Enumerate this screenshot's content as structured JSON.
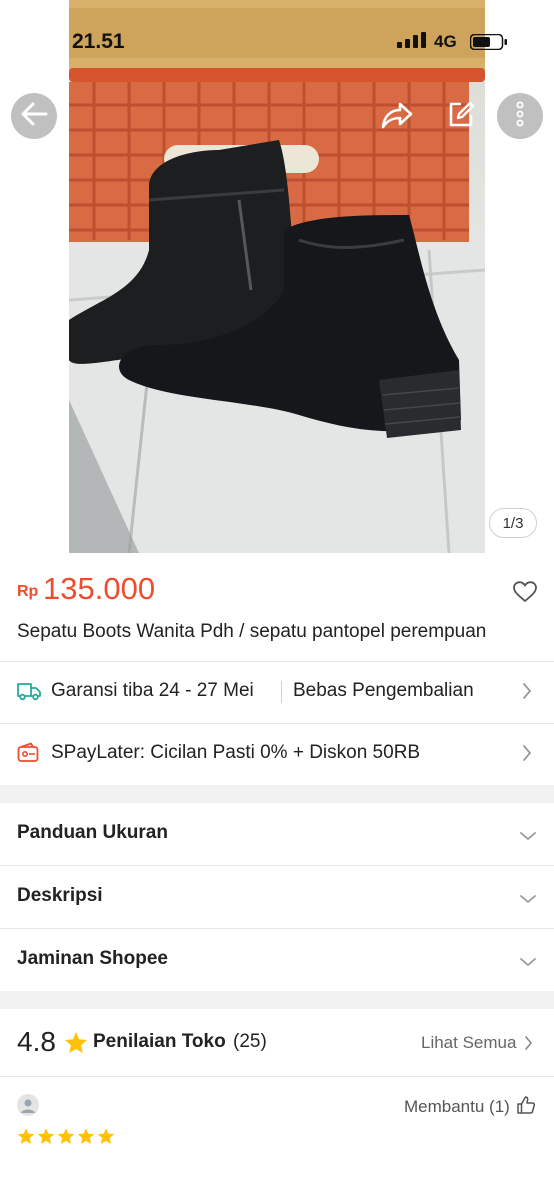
{
  "status_bar": {
    "time": "21.51",
    "network": "4G"
  },
  "gallery": {
    "counter": "1/3"
  },
  "product": {
    "currency": "Rp",
    "price": "135.000",
    "title": "Sepatu Boots Wanita Pdh / sepatu pantopel perempuan"
  },
  "shipping": {
    "guarantee": "Garansi tiba 24 - 27 Mei",
    "returns": "Bebas Pengembalian"
  },
  "paylater": {
    "label": "SPayLater: Cicilan Pasti 0% + Diskon 50RB"
  },
  "accordion": [
    {
      "label": "Panduan Ukuran"
    },
    {
      "label": "Deskripsi"
    },
    {
      "label": "Jaminan Shopee"
    }
  ],
  "rating": {
    "score": "4.8",
    "label": "Penilaian Toko",
    "count": "(25)",
    "see_all": "Lihat Semua"
  },
  "review": {
    "helpful": "Membantu (1)",
    "stars": 5
  },
  "colors": {
    "accent": "#ee4d2d",
    "star": "#ffc107",
    "teal": "#26aa99"
  }
}
